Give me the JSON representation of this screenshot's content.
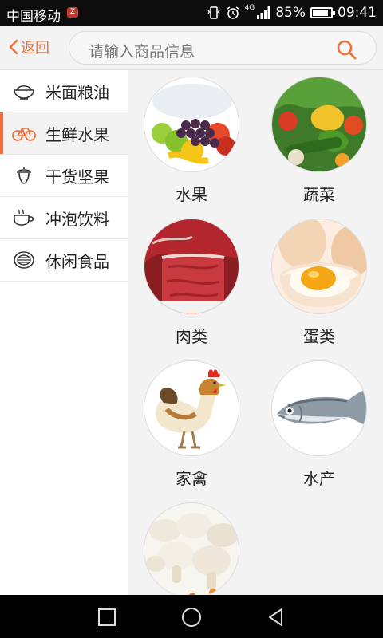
{
  "status_bar": {
    "carrier": "中国移动",
    "sim_badge": "Z",
    "network": "4G",
    "battery": "85%",
    "battery_level": 0.85,
    "time": "09:41"
  },
  "header": {
    "back_label": "返回",
    "search_placeholder": "请输入商品信息"
  },
  "sidebar": {
    "items": [
      {
        "label": "米面粮油",
        "icon": "rice-bowl-icon",
        "active": false
      },
      {
        "label": "生鲜水果",
        "icon": "bicycle-icon",
        "active": true
      },
      {
        "label": "干货坚果",
        "icon": "acorn-icon",
        "active": false
      },
      {
        "label": "冲泡饮料",
        "icon": "coffee-cup-icon",
        "active": false
      },
      {
        "label": "休闲食品",
        "icon": "snack-bowl-icon",
        "active": false
      }
    ]
  },
  "categories": [
    {
      "label": "水果",
      "image": "fruit-image"
    },
    {
      "label": "蔬菜",
      "image": "vegetable-image"
    },
    {
      "label": "肉类",
      "image": "meat-image"
    },
    {
      "label": "蛋类",
      "image": "egg-image"
    },
    {
      "label": "家禽",
      "image": "poultry-image"
    },
    {
      "label": "水产",
      "image": "fish-image"
    },
    {
      "label": "",
      "image": "mushroom-image"
    }
  ],
  "colors": {
    "accent": "#f0703b",
    "status_bar": "#0d0d0d",
    "nav_bar": "#000000"
  }
}
